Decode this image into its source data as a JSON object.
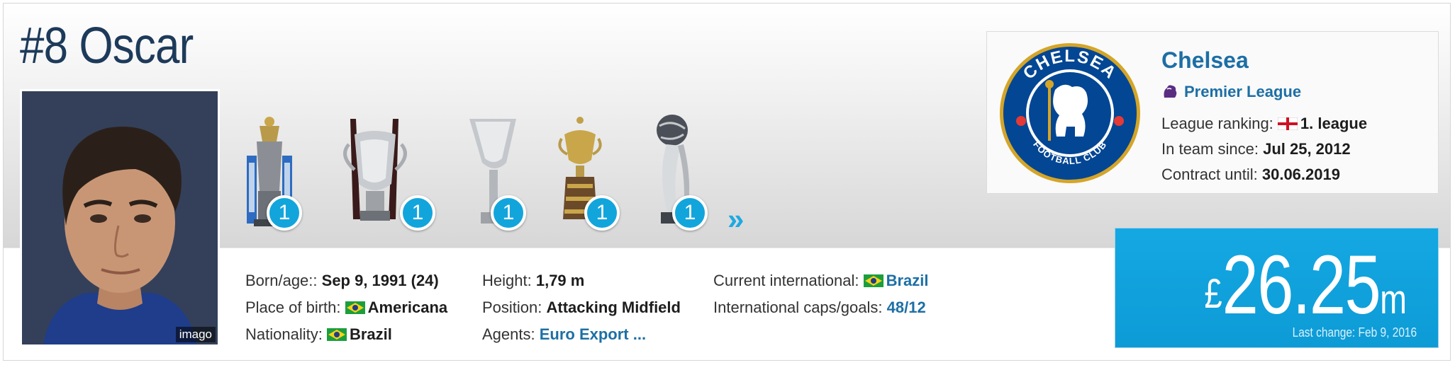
{
  "header": {
    "title": "#8 Oscar"
  },
  "photo": {
    "credit": "imago"
  },
  "trophies": [
    {
      "icon": "premier-league-trophy-icon",
      "count": "1"
    },
    {
      "icon": "league-cup-trophy-icon",
      "count": "1"
    },
    {
      "icon": "europa-league-trophy-icon",
      "count": "1"
    },
    {
      "icon": "copa-libertadores-trophy-icon",
      "count": "1"
    },
    {
      "icon": "club-world-cup-trophy-icon",
      "count": "1"
    }
  ],
  "more_icon": "double-chevron-right-icon",
  "personal": {
    "born_label": "Born/age::",
    "born_value": "Sep 9, 1991 (24)",
    "birthplace_label": "Place of birth:",
    "birthplace_value": "Americana",
    "nationality_label": "Nationality:",
    "nationality_value": "Brazil"
  },
  "physical": {
    "height_label": "Height:",
    "height_value": "1,79 m",
    "position_label": "Position:",
    "position_value": "Attacking Midfield",
    "agents_label": "Agents:",
    "agents_value": "Euro Export ..."
  },
  "international": {
    "current_label": "Current international:",
    "current_value": "Brazil",
    "caps_label": "International caps/goals:",
    "caps": "48",
    "separator": "/",
    "goals": "12"
  },
  "club": {
    "name": "Chelsea",
    "league": "Premier League",
    "ranking_label": "League ranking:",
    "ranking_value": "1. league",
    "since_label": "In team since:",
    "since_value": "Jul 25, 2012",
    "contract_label": "Contract until:",
    "contract_value": "30.06.2019",
    "logo_text_top": "CHELSEA",
    "logo_text_bottom": "FOOTBALL CLUB"
  },
  "market_value": {
    "currency": "£",
    "amount": "26.25",
    "unit": "m",
    "last_change": "Last change: Feb 9, 2016"
  },
  "colors": {
    "accent": "#12a5dc",
    "link": "#1d6fa5",
    "title": "#1d3a5a"
  }
}
